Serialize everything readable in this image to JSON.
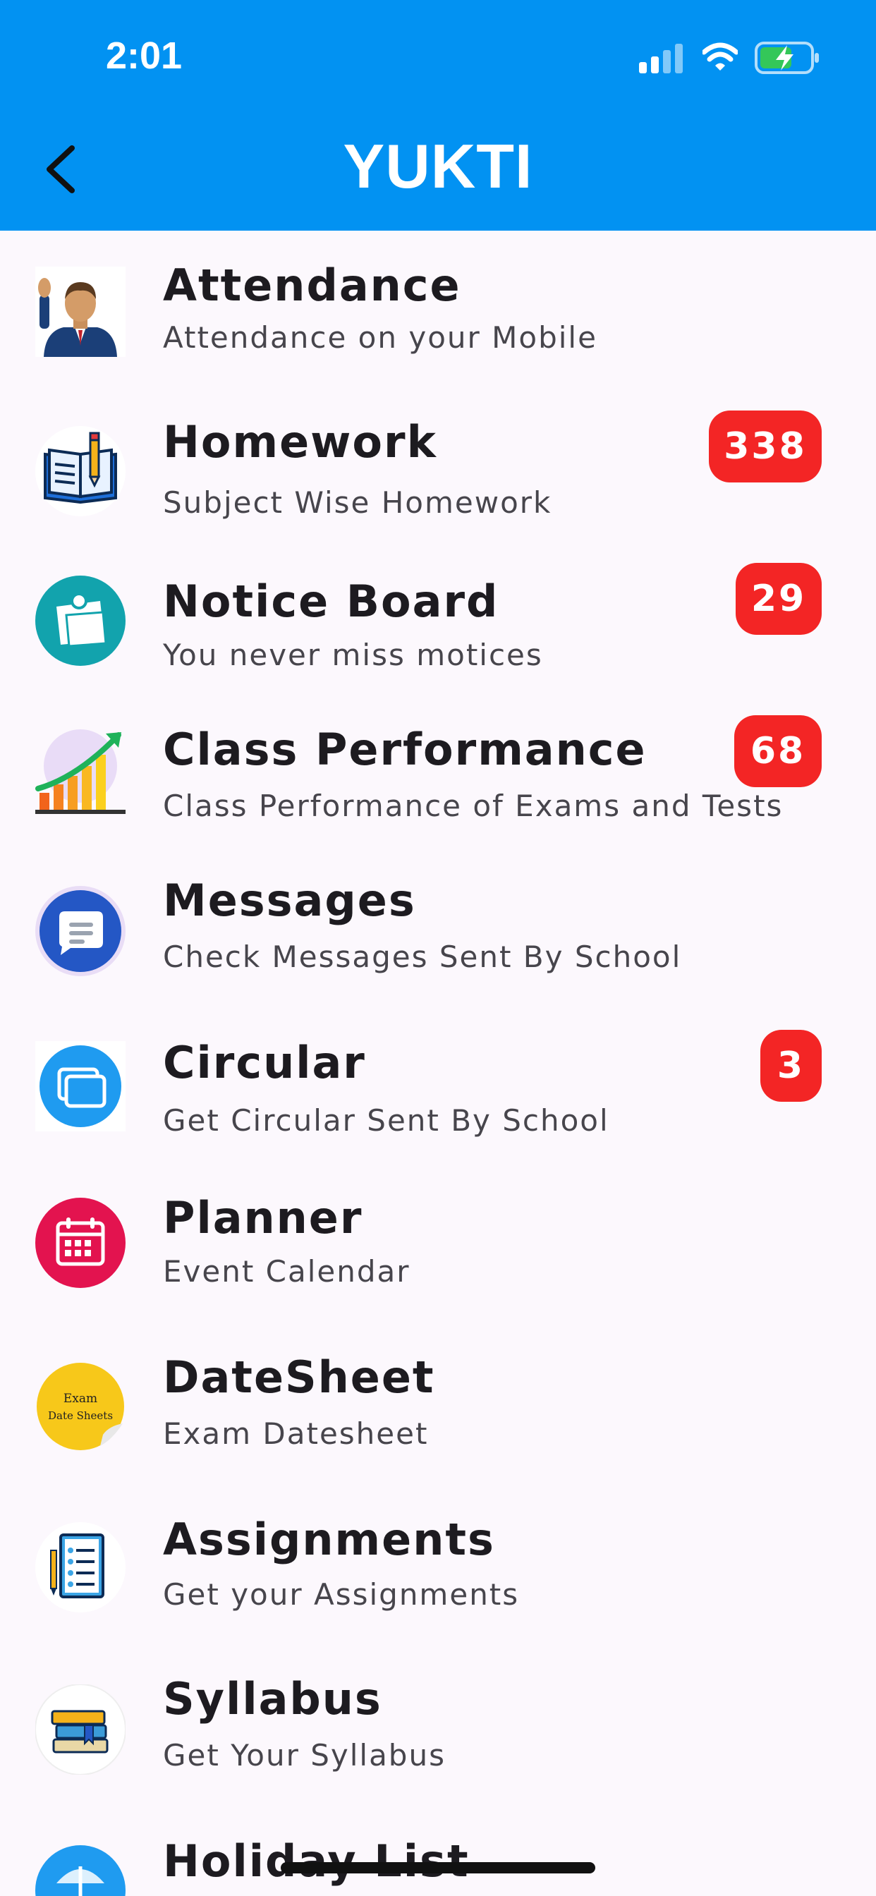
{
  "status": {
    "time": "2:01"
  },
  "header": {
    "title": "YUKTI"
  },
  "items": [
    {
      "title": "Attendance",
      "subtitle": "Attendance on your Mobile",
      "badge": "",
      "icon": "attendance-icon"
    },
    {
      "title": "Homework",
      "subtitle": "Subject Wise Homework",
      "badge": "338",
      "icon": "homework-book-icon"
    },
    {
      "title": "Notice Board",
      "subtitle": "You never miss motices",
      "badge": "29",
      "icon": "notice-board-icon"
    },
    {
      "title": "Class Performance",
      "subtitle": "Class Performance of Exams and Tests",
      "badge": "68",
      "icon": "performance-chart-icon"
    },
    {
      "title": "Messages",
      "subtitle": "Check Messages Sent By School",
      "badge": "",
      "icon": "message-bubble-icon"
    },
    {
      "title": "Circular",
      "subtitle": "Get Circular Sent By School",
      "badge": "3",
      "icon": "circular-cards-icon"
    },
    {
      "title": "Planner",
      "subtitle": "Event Calendar",
      "badge": "",
      "icon": "calendar-icon"
    },
    {
      "title": "DateSheet",
      "subtitle": "Exam Datesheet",
      "badge": "",
      "icon": "datesheet-sticker-icon",
      "icon_text": [
        "Exam",
        "Date Sheets"
      ]
    },
    {
      "title": "Assignments",
      "subtitle": "Get your Assignments",
      "badge": "",
      "icon": "assignment-clipboard-icon"
    },
    {
      "title": "Syllabus",
      "subtitle": "Get Your Syllabus",
      "badge": "",
      "icon": "books-stack-icon"
    },
    {
      "title": "Holiday List",
      "subtitle": "",
      "badge": "",
      "icon": "holiday-umbrella-icon"
    }
  ],
  "colors": {
    "header": "#0292f2",
    "badge": "#f32525",
    "background": "#fcf8fd"
  }
}
